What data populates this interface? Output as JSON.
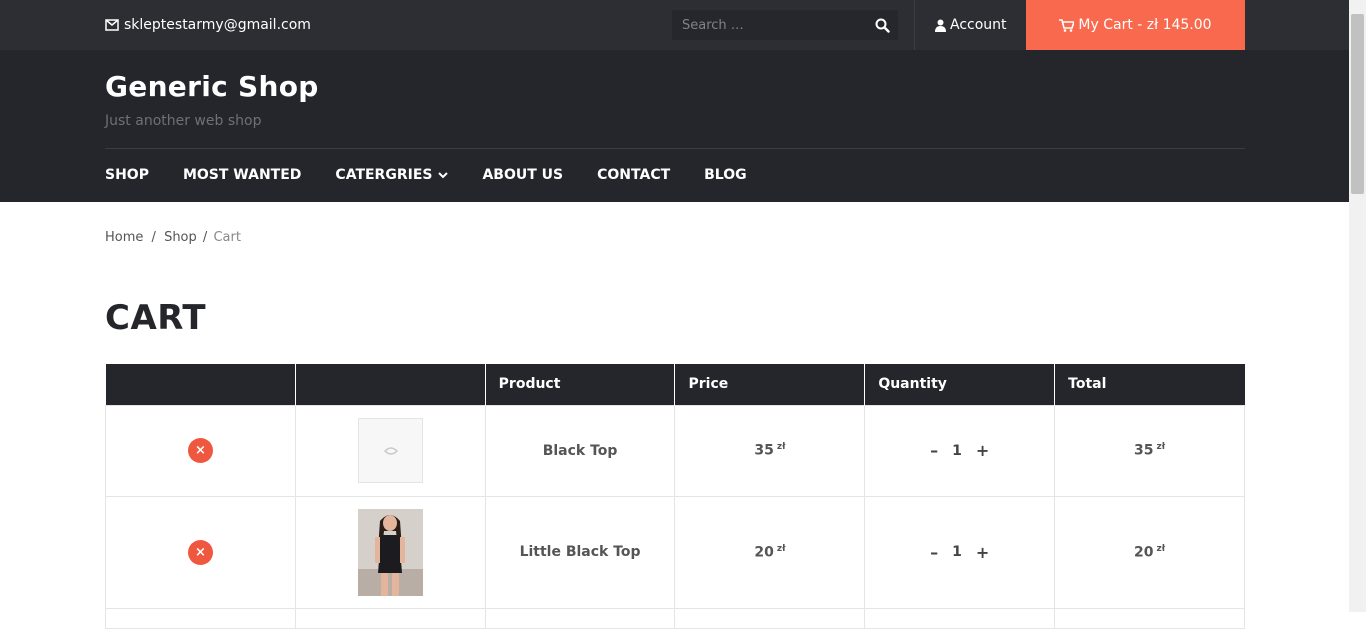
{
  "topbar": {
    "email": "skleptestarmy@gmail.com",
    "search_placeholder": "Search …",
    "account_label": "Account",
    "cart_label": "My Cart - zł 145.00"
  },
  "header": {
    "site_title": "Generic Shop",
    "tagline": "Just another web shop"
  },
  "nav": {
    "items": [
      "SHOP",
      "MOST WANTED",
      "CATERGRIES",
      "ABOUT US",
      "CONTACT",
      "BLOG"
    ]
  },
  "breadcrumb": {
    "home": "Home",
    "sep1": "/",
    "shop": "Shop",
    "sep2": "/",
    "current": "Cart"
  },
  "page_title": "CART",
  "cart_table": {
    "headers": [
      "",
      "",
      "Product",
      "Price",
      "Quantity",
      "Total"
    ],
    "rows": [
      {
        "remove": "×",
        "name": "Black Top",
        "price": "35",
        "currency": "zł",
        "qty": "1",
        "minus": "–",
        "plus": "+",
        "total": "35",
        "has_photo": false
      },
      {
        "remove": "×",
        "name": "Little Black Top",
        "price": "20",
        "currency": "zł",
        "qty": "1",
        "minus": "–",
        "plus": "+",
        "total": "20",
        "has_photo": true
      }
    ]
  },
  "colors": {
    "accent": "#f8694d",
    "dark": "#24262c",
    "topbar": "#2c2e34",
    "remove": "#f0573f"
  }
}
